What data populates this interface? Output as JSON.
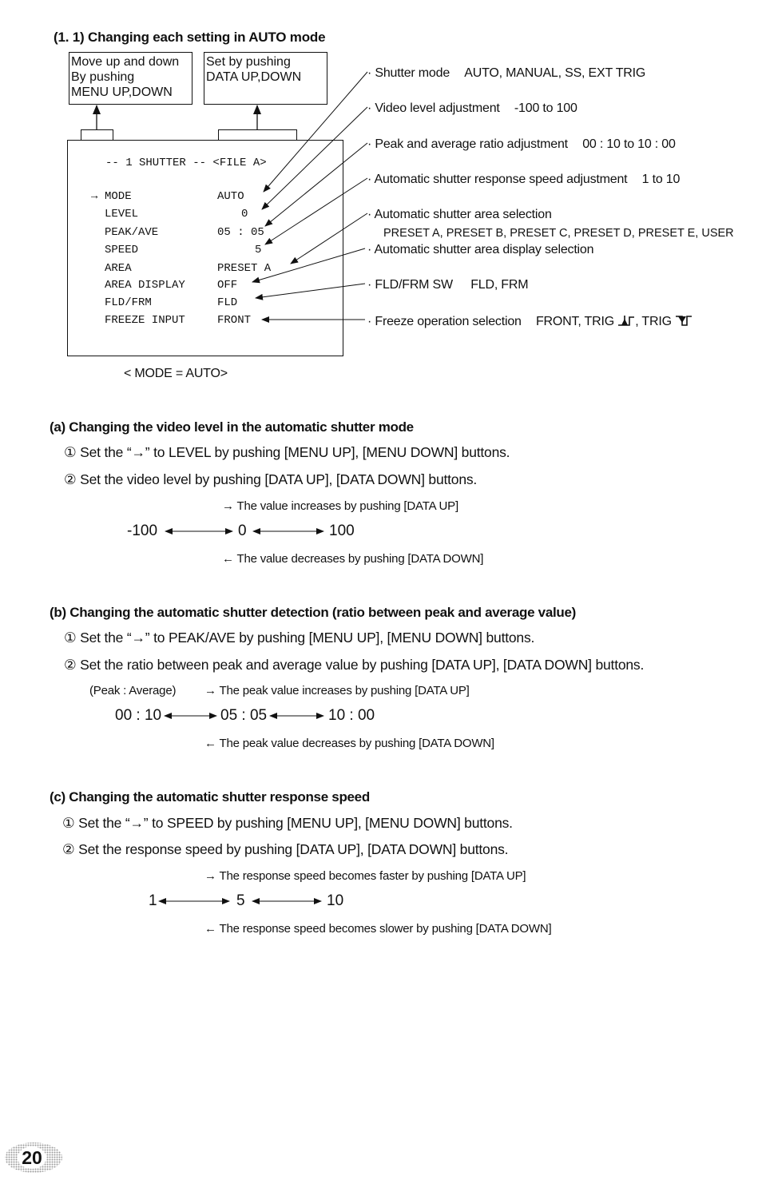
{
  "section_title": "(1. 1)  Changing each setting in AUTO mode",
  "callout_boxes": {
    "menu": [
      "Move up and down",
      "By pushing",
      "MENU UP,DOWN"
    ],
    "data": [
      "Set by pushing",
      "DATA UP,DOWN"
    ]
  },
  "screen": {
    "header": "--  1  SHUTTER --  <FILE A>",
    "cursor": "→",
    "rows": [
      {
        "label": "MODE",
        "value": "AUTO"
      },
      {
        "label": "LEVEL",
        "value": "0"
      },
      {
        "label": "PEAK/AVE",
        "value": "05 : 05"
      },
      {
        "label": "SPEED",
        "value": "5"
      },
      {
        "label": "AREA",
        "value": "PRESET A"
      },
      {
        "label": "AREA DISPLAY",
        "value": "OFF"
      },
      {
        "label": "FLD/FRM",
        "value": "FLD"
      },
      {
        "label": "FREEZE INPUT",
        "value": "FRONT"
      }
    ],
    "caption": "< MODE = AUTO>"
  },
  "annotations": [
    {
      "label": "Shutter mode",
      "range": "AUTO, MANUAL, SS, EXT TRIG"
    },
    {
      "label": "Video level adjustment",
      "range": "-100 to 100"
    },
    {
      "label": "Peak and average ratio adjustment",
      "range": "00 : 10 to 10 : 00"
    },
    {
      "label": "Automatic shutter response speed adjustment",
      "range": "1 to 10"
    },
    {
      "label": "Automatic shutter area selection",
      "range": "PRESET A, PRESET B, PRESET C, PRESET D, PRESET E, USER"
    },
    {
      "label": "Automatic shutter area display selection",
      "range": ""
    },
    {
      "label": "FLD/FRM SW",
      "range": "FLD, FRM"
    },
    {
      "label": "Freeze operation selection",
      "range": "FRONT, TRIG",
      "trig_sep": ", TRIG"
    }
  ],
  "sections": {
    "a": {
      "title": "(a) Changing the video level in the automatic shutter mode",
      "step1": "① Set the “→” to LEVEL by pushing [MENU UP], [MENU DOWN] buttons.",
      "step2": "② Set the video level by pushing [DATA UP], [DATA DOWN] buttons.",
      "up_note": "→  The value increases by pushing [DATA UP]",
      "down_note": "←  The value decreases by pushing [DATA DOWN]",
      "scale": [
        "-100",
        "0",
        "100"
      ]
    },
    "b": {
      "title": "(b) Changing the automatic shutter detection (ratio between peak and average value)",
      "step1": "① Set the “→” to PEAK/AVE by pushing [MENU UP], [MENU DOWN] buttons.",
      "step2": "② Set the ratio between peak and average value by pushing [DATA UP], [DATA DOWN] buttons.",
      "ratio_label": "(Peak : Average)",
      "up_note": "→  The peak value increases by pushing [DATA UP]",
      "down_note": "←  The peak value decreases by pushing [DATA DOWN]",
      "scale": [
        "00 : 10",
        "05 : 05",
        "10 : 00"
      ]
    },
    "c": {
      "title": "(c) Changing the automatic shutter response speed",
      "step1": "① Set the “→” to SPEED by pushing [MENU UP], [MENU DOWN] buttons.",
      "step2": "② Set the response speed by pushing [DATA UP], [DATA DOWN] buttons.",
      "up_note": "→  The response speed becomes faster by pushing [DATA UP]",
      "down_note": "←  The response speed becomes slower by pushing [DATA DOWN]",
      "scale": [
        "1",
        "5",
        "10"
      ]
    }
  },
  "page_number": "20"
}
